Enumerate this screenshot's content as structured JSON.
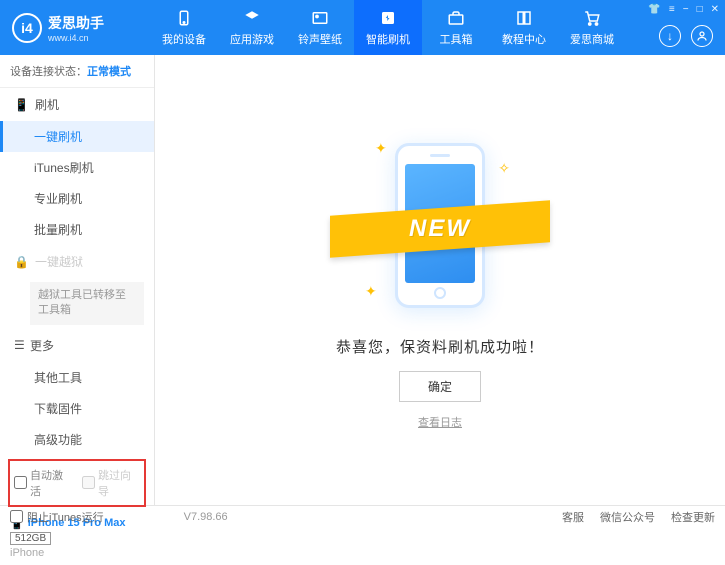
{
  "header": {
    "logo_title": "爱思助手",
    "logo_url": "www.i4.cn",
    "logo_letter": "i4",
    "nav": [
      {
        "label": "我的设备"
      },
      {
        "label": "应用游戏"
      },
      {
        "label": "铃声壁纸"
      },
      {
        "label": "智能刷机"
      },
      {
        "label": "工具箱"
      },
      {
        "label": "教程中心"
      },
      {
        "label": "爱思商城"
      }
    ]
  },
  "sidebar": {
    "status_label": "设备连接状态：",
    "status_value": "正常模式",
    "section_flash": "刷机",
    "items_flash": [
      "一键刷机",
      "iTunes刷机",
      "专业刷机",
      "批量刷机"
    ],
    "section_jailbreak": "一键越狱",
    "jailbreak_note": "越狱工具已转移至工具箱",
    "section_more": "更多",
    "items_more": [
      "其他工具",
      "下载固件",
      "高级功能"
    ],
    "opt_auto_activate": "自动激活",
    "opt_skip_guide": "跳过向导",
    "device_name": "iPhone 15 Pro Max",
    "device_storage": "512GB",
    "device_type": "iPhone"
  },
  "main": {
    "new_text": "NEW",
    "success_msg": "恭喜您，保资料刷机成功啦！",
    "ok_button": "确定",
    "log_link": "查看日志"
  },
  "footer": {
    "block_itunes": "阻止iTunes运行",
    "version": "V7.98.66",
    "support": "客服",
    "wechat": "微信公众号",
    "update": "检查更新"
  }
}
